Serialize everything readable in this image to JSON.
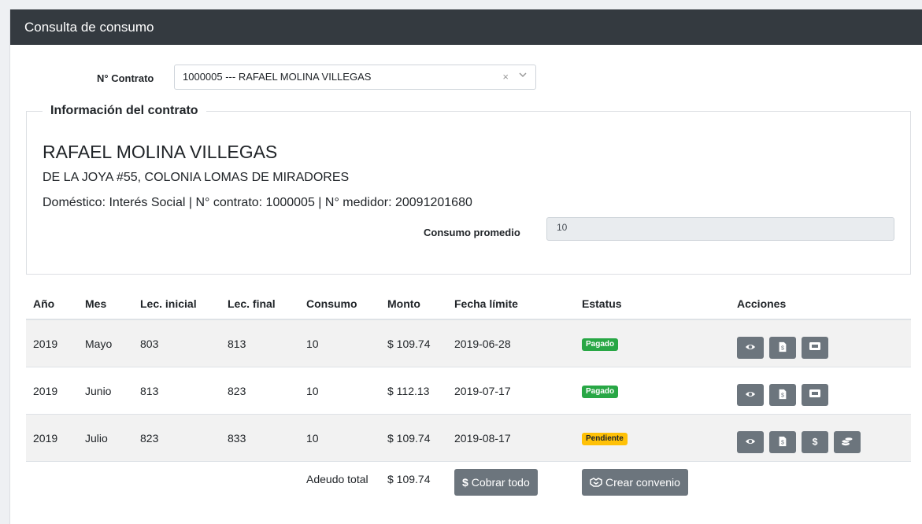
{
  "header": {
    "title": "Consulta de consumo"
  },
  "contract_select": {
    "label": "N° Contrato",
    "value": "1000005 --- RAFAEL MOLINA VILLEGAS",
    "clear_icon": "×",
    "caret_icon": "chevron-down-icon"
  },
  "info": {
    "legend": "Información del contrato",
    "name": "RAFAEL MOLINA VILLEGAS",
    "address": "DE LA JOYA #55, COLONIA LOMAS DE MIRADORES",
    "details": "Doméstico: Interés Social | N° contrato: 1000005 | N° medidor: 20091201680",
    "avg_label": "Consumo promedio",
    "avg_value": "10"
  },
  "table": {
    "headers": [
      "Año",
      "Mes",
      "Lec. inicial",
      "Lec. final",
      "Consumo",
      "Monto",
      "Fecha límite",
      "Estatus",
      "Acciones"
    ],
    "rows": [
      {
        "year": "2019",
        "month": "Mayo",
        "start": "803",
        "end": "813",
        "consumo": "10",
        "monto": "$ 109.74",
        "fecha": "2019-06-28",
        "status": "Pagado"
      },
      {
        "year": "2019",
        "month": "Junio",
        "start": "813",
        "end": "823",
        "consumo": "10",
        "monto": "$ 112.13",
        "fecha": "2019-07-17",
        "status": "Pagado"
      },
      {
        "year": "2019",
        "month": "Julio",
        "start": "823",
        "end": "833",
        "consumo": "10",
        "monto": "$ 109.74",
        "fecha": "2019-08-17",
        "status": "Pendiente"
      }
    ],
    "total_label": "Adeudo total",
    "total_value": "$ 109.74",
    "pay_all_label": "Cobrar todo",
    "agreement_label": "Crear convenio"
  },
  "colors": {
    "header_bg": "#343a40",
    "paid": "#28a745",
    "pending": "#ffc107",
    "button": "#6c757d"
  }
}
